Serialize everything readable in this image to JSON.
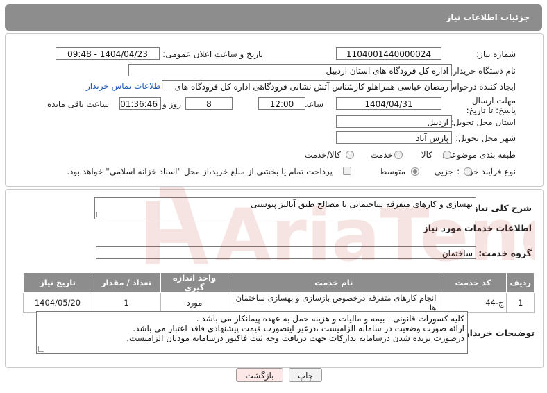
{
  "header": {
    "title": "جزئیات اطلاعات نیاز"
  },
  "fields": {
    "need_number_label": "شماره نیاز:",
    "need_number": "1104001440000024",
    "announce_label": "تاریخ و ساعت اعلان عمومی:",
    "announce_value": "1404/04/23 - 09:48",
    "buyer_org_label": "نام دستگاه خریدار:",
    "buyer_org": "اداره کل فرودگاه های استان اردبیل",
    "creator_label": "ایجاد کننده درخواست:",
    "creator": "رمضان عباسی همراهلو  کارشناس آتش نشانی فرودگاهی اداره کل فرودگاه های",
    "contact_link": "اطلاعات تماس خریدار",
    "deadline_label": "مهلت ارسال پاسخ: تا تاریخ:",
    "deadline_date": "1404/04/31",
    "time_label": "ساعت",
    "deadline_time": "12:00",
    "days_value": "8",
    "days_label": "روز و",
    "remaining_time": "01:36:46",
    "remaining_label": "ساعت باقی مانده",
    "province_label": "استان محل تحویل:",
    "province": "اردبیل",
    "city_label": "شهر محل تحویل:",
    "city": "پارس آباد",
    "category_label": "طبقه بندی موضوعی:",
    "category_options": [
      "کالا",
      "خدمت",
      "کالا/خدمت"
    ],
    "process_label": "نوع فرآیند خرید :",
    "process_options": [
      "جزیی",
      "متوسط"
    ],
    "payment_note": "پرداخت تمام یا بخشی از مبلغ خرید،از محل \"اسناد خزانه اسلامی\" خواهد بود."
  },
  "description": {
    "label": "شرح کلی نیاز:",
    "text": "بهسازی و کارهای متفرقه ساختمانی با مصالح طبق آنالیز پیوستی"
  },
  "services": {
    "section_title": "اطلاعات خدمات مورد نیاز",
    "group_label": "گروه خدمت:",
    "group_value": "ساختمان",
    "columns": [
      "ردیف",
      "کد خدمت",
      "نام خدمت",
      "واحد اندازه گیری",
      "تعداد / مقدار",
      "تاریخ نیاز"
    ],
    "rows": [
      {
        "row": "1",
        "code": "ج-44",
        "name": "انجام کارهای متفرقه درخصوص بازسازی و بهسازی ساختمان ها",
        "unit": "مورد",
        "qty": "1",
        "date": "1404/05/20"
      }
    ]
  },
  "buyer_notes": {
    "label": "توضیحات خریدار:",
    "lines": [
      "کلیه کسورات قانونی - بیمه و مالیات و هزینه حمل به عهده پیمانکار می باشد .",
      "ارائه صورت وضعیت در سامانه الزامیست ،درغیر اینصورت قیمت پیشنهادی فاقد اعتبار می باشد.",
      "درصورت برنده شدن درسامانه تدارکات جهت دریافت وجه ثبت فاکتور درسامانه مودیان الزامیست."
    ]
  },
  "buttons": {
    "print": "چاپ",
    "back": "بازگشت"
  },
  "colors": {
    "header_bg": "#8d8d8d",
    "link": "#1a57b5",
    "back_bg": "#fde8e8",
    "watermark": "#c0392b"
  },
  "watermark": {
    "text": "AriaTender.neT"
  }
}
